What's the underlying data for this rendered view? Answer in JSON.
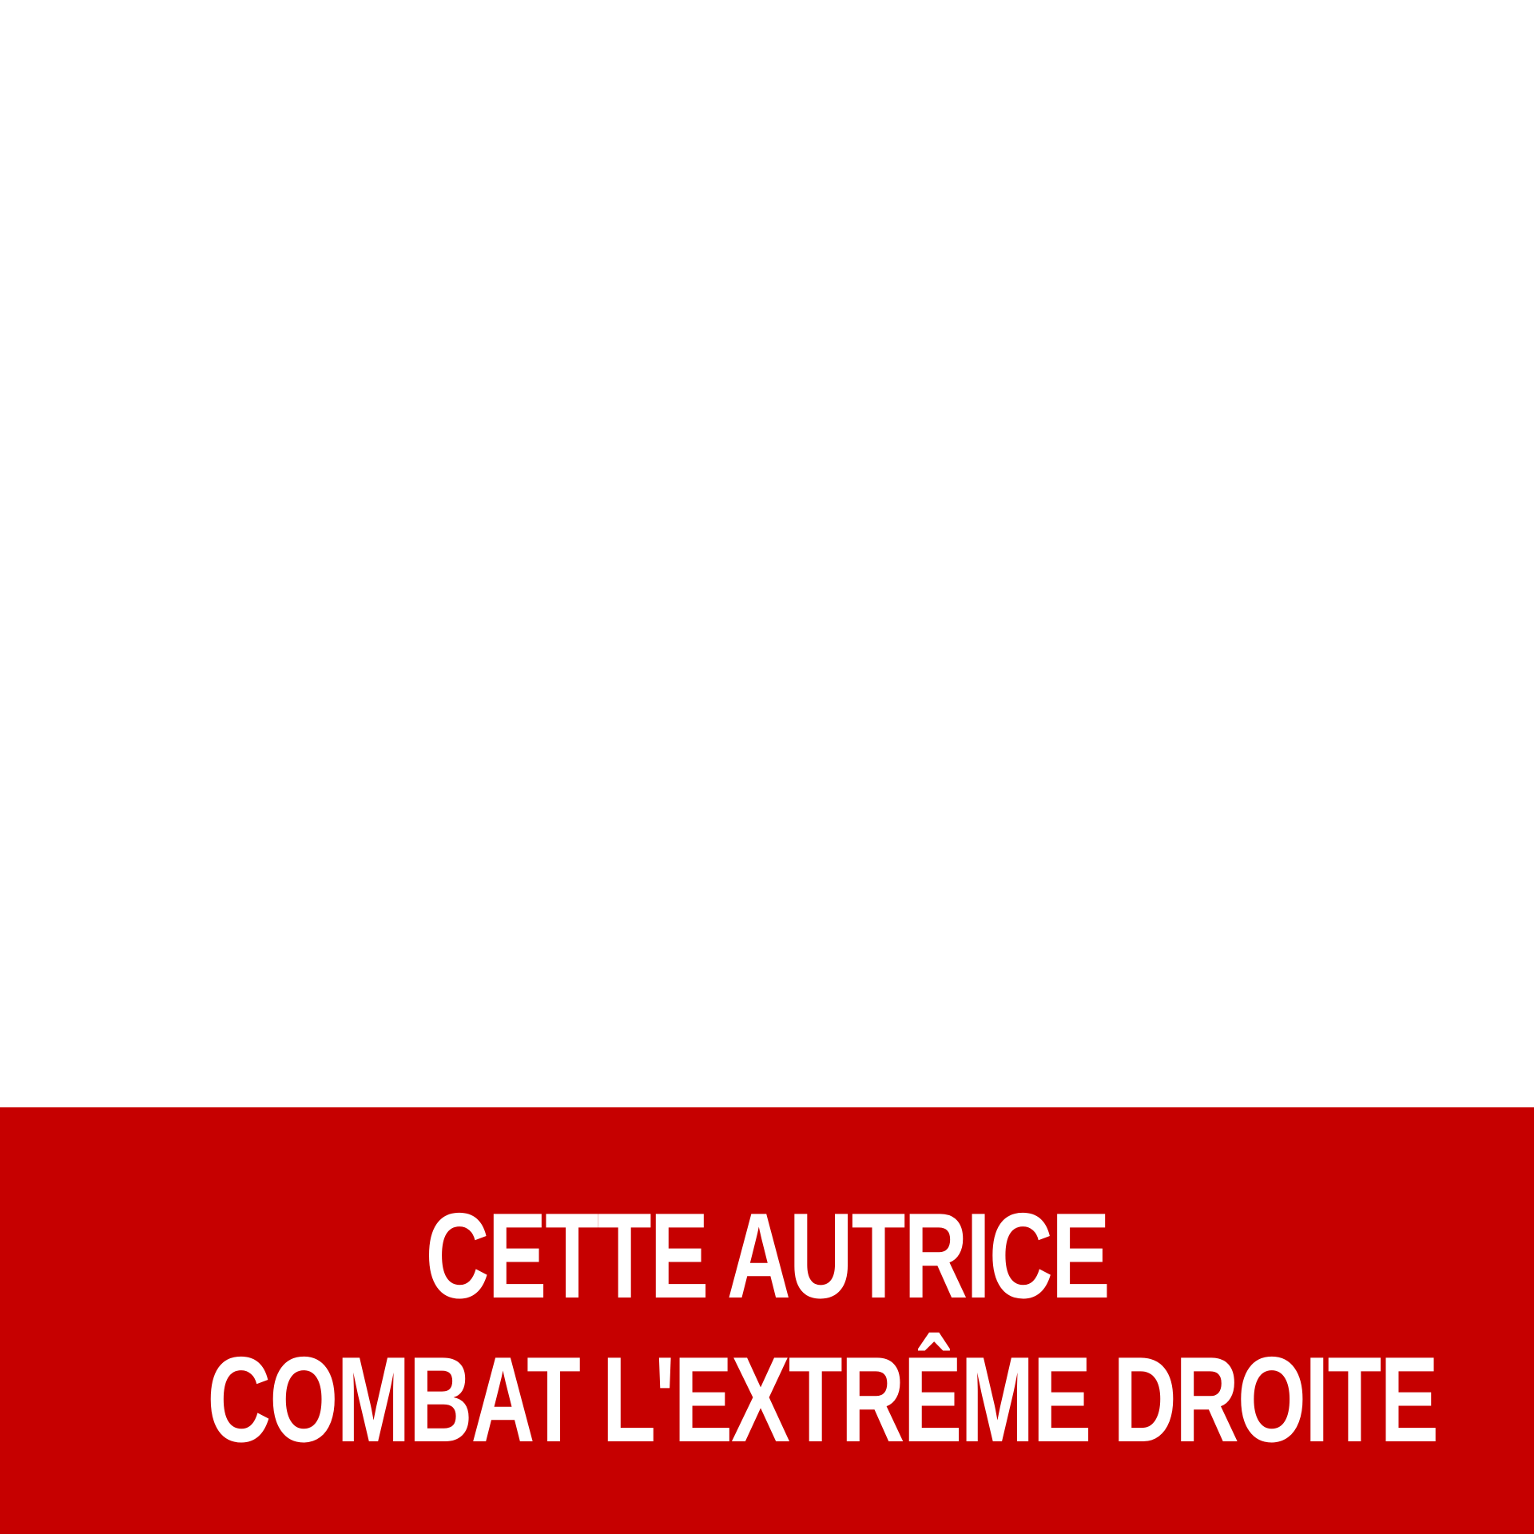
{
  "banner": {
    "background_color": "#c60000",
    "text_color": "#ffffff",
    "headline_line_1": "CETTE AUTRICE",
    "headline_line_2": "COMBAT L'EXTRÊME DROITE"
  },
  "top_area": {
    "background_color": "#ffffff"
  }
}
